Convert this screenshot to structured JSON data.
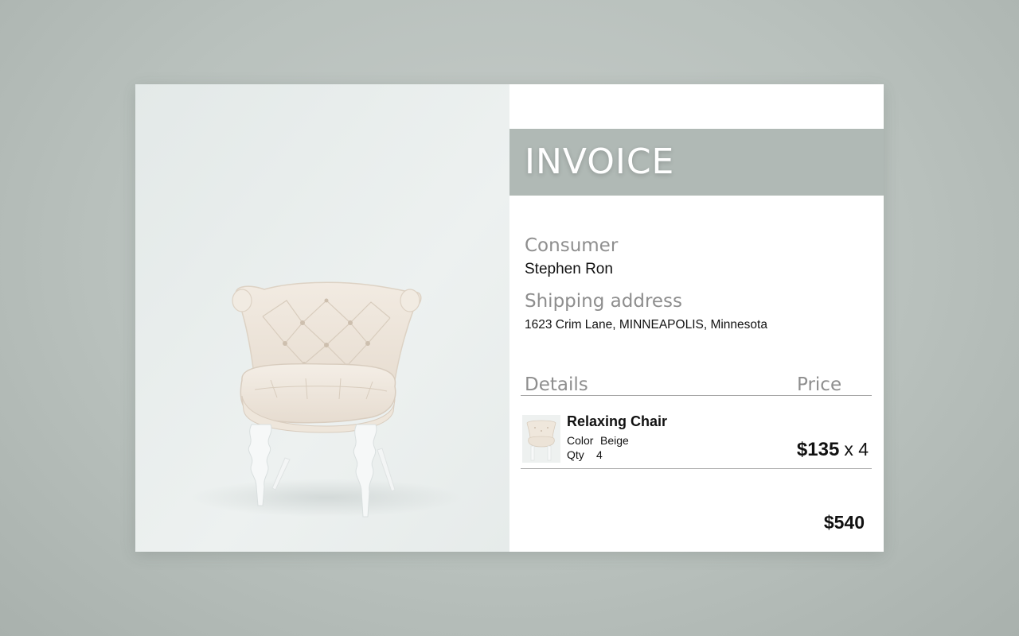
{
  "invoice": {
    "title": "INVOICE",
    "consumer_label": "Consumer",
    "consumer_name": "Stephen Ron",
    "shipping_label": "Shipping address",
    "shipping_address": "1623  Crim Lane, MINNEAPOLIS, Minnesota",
    "details_header": "Details",
    "price_header": "Price",
    "item": {
      "name": "Relaxing Chair",
      "color_label": "Color",
      "color_value": "Beige",
      "qty_label": "Qty",
      "qty_value": "4",
      "unit_price": "$135",
      "multiplier": "x 4"
    },
    "total": "$540"
  },
  "image": {
    "subject": "armchair-photo",
    "thumbnail": "chair-thumbnail"
  },
  "colors": {
    "background": "#bfc6c2",
    "banner": "#b0b9b5",
    "label_gray": "#8e8e8e",
    "text": "#111111"
  }
}
